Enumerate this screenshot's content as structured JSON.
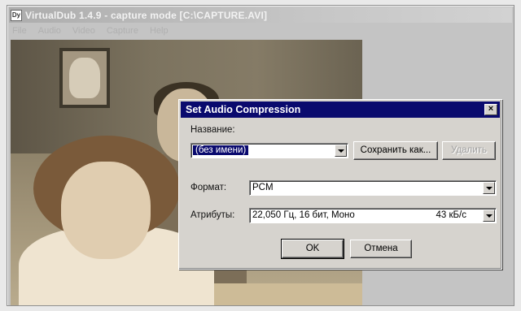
{
  "app": {
    "icon": "Dy",
    "title": "VirtualDub 1.4.9 - capture mode [C:\\CAPTURE.AVI]",
    "menu": [
      "File",
      "Audio",
      "Video",
      "Capture",
      "Help"
    ]
  },
  "dialog": {
    "title": "Set Audio Compression",
    "close_label": "×",
    "name_label": "Название:",
    "name_value": "(без имени)",
    "save_as_label": "Сохранить как...",
    "delete_label": "Удалить",
    "format_label": "Формат:",
    "format_value": "PCM",
    "attributes_label": "Атрибуты:",
    "attributes_value": "22,050 Гц, 16 бит, Моно",
    "attributes_rate": "43 кБ/с",
    "ok_label": "OK",
    "cancel_label": "Отмена"
  },
  "icons": [
    "app-icon",
    "close-icon",
    "dropdown-arrow-icon"
  ],
  "colors": {
    "title_bar": "#0a0a6e",
    "dialog_face": "#d6d3ce"
  }
}
